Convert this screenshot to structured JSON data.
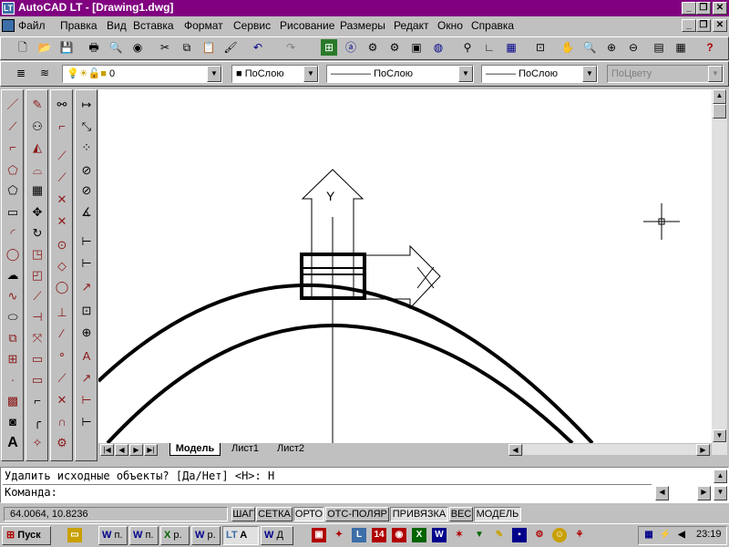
{
  "window": {
    "title": "AutoCAD LT - [Drawing1.dwg]",
    "app_icon": "LT",
    "controls": [
      "_",
      "❐",
      "✕"
    ],
    "doc_controls": [
      "_",
      "❐",
      "✕"
    ]
  },
  "menu": [
    "Файл",
    "Правка",
    "Вид",
    "Вставка",
    "Формат",
    "Сервис",
    "Рисование",
    "Размеры",
    "Редакт",
    "Окно",
    "Справка"
  ],
  "standard_toolbar_icons": [
    "new-icon",
    "open-icon",
    "save-icon",
    "print-icon",
    "preview-icon",
    "publish-icon",
    "cut-icon",
    "copy-icon",
    "paste-icon",
    "matchprop-icon",
    "undo-icon",
    "redo-icon",
    "design-center-icon",
    "web-icon",
    "properties-icon",
    "tool-palettes-icon",
    "pan-icon",
    "zoom-icon",
    "zoom-window-icon",
    "zoom-previous-icon",
    "help-icon"
  ],
  "properties_bar": {
    "layer_value": "0",
    "color_value": "ПоСлою",
    "linetype_value": "ПоСлою",
    "lineweight_value": "ПоСлою",
    "plotstyle_value": "ПоЦвету"
  },
  "layout_tabs": [
    "Модель",
    "Лист1",
    "Лист2"
  ],
  "active_tab": "Модель",
  "command": {
    "history": "Удалить исходные объекты? [Да/Нет] <Н>: Н",
    "prompt": "Команда:"
  },
  "status": {
    "coordinates": "64.0064, 10.8236",
    "toggles": [
      "ШАГ",
      "СЕТКА",
      "ОРТО",
      "ОТС-ПОЛЯР",
      "ПРИВЯЗКА",
      "ВЕС",
      "МОДЕЛЬ"
    ]
  },
  "taskbar": {
    "start": "Пуск",
    "buttons": [
      "п.",
      "п.",
      "р.",
      "р.",
      "A",
      "Д"
    ],
    "clock": "23:19"
  },
  "ucs_labels": {
    "y": "Y"
  },
  "colors": {
    "titlebar": "#800080",
    "canvas": "#ffffff",
    "face": "#c0c0c0"
  }
}
